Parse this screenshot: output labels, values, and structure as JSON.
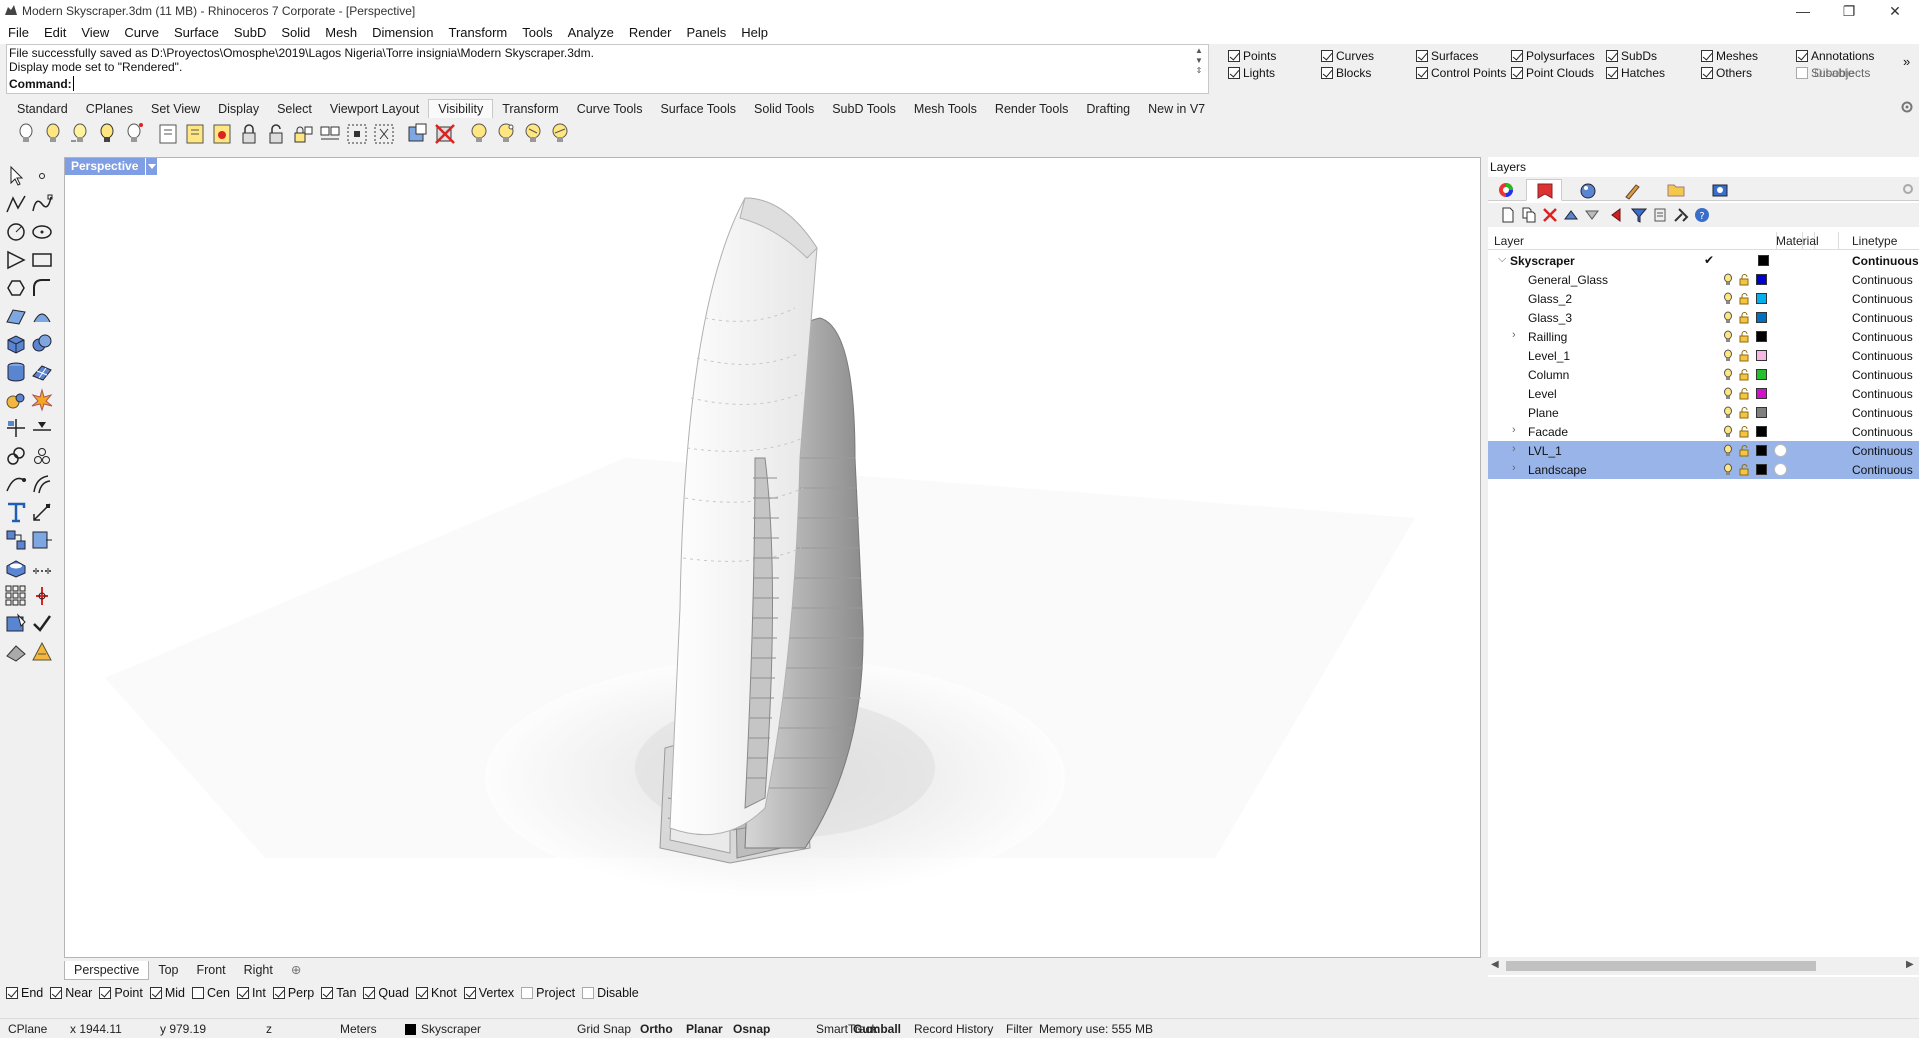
{
  "window": {
    "title": "Modern Skyscraper.3dm (11 MB) - Rhinoceros 7 Corporate - [Perspective]",
    "minimize": "—",
    "maximize": "❐",
    "close": "✕"
  },
  "menu": [
    "File",
    "Edit",
    "View",
    "Curve",
    "Surface",
    "SubD",
    "Solid",
    "Mesh",
    "Dimension",
    "Transform",
    "Tools",
    "Analyze",
    "Render",
    "Panels",
    "Help"
  ],
  "command": {
    "history": [
      "File successfully saved as D:\\Proyectos\\Omosphe\\2019\\Lagos Nigeria\\Torre insignia\\Modern Skyscraper.3dm.",
      "Display mode set to \"Rendered\"."
    ],
    "prompt": "Command:"
  },
  "select_filters": [
    {
      "label": "Points",
      "checked": true
    },
    {
      "label": "Curves",
      "checked": true
    },
    {
      "label": "Surfaces",
      "checked": true
    },
    {
      "label": "Polysurfaces",
      "checked": true
    },
    {
      "label": "SubDs",
      "checked": true
    },
    {
      "label": "Meshes",
      "checked": true
    },
    {
      "label": "Annotations",
      "checked": true
    },
    {
      "label": "Lights",
      "checked": true
    },
    {
      "label": "Blocks",
      "checked": true
    },
    {
      "label": "Control Points",
      "checked": true
    },
    {
      "label": "Point Clouds",
      "checked": true
    },
    {
      "label": "Hatches",
      "checked": true
    },
    {
      "label": "Others",
      "checked": true
    },
    {
      "label": "Subobjects",
      "checked": false,
      "overlay": "Disable"
    }
  ],
  "filters_more": "»",
  "toolbar_tabs": [
    "Standard",
    "CPlanes",
    "Set View",
    "Display",
    "Select",
    "Viewport Layout",
    "Visibility",
    "Transform",
    "Curve Tools",
    "Surface Tools",
    "Solid Tools",
    "SubD Tools",
    "Mesh Tools",
    "Render Tools",
    "Drafting",
    "New in V7"
  ],
  "active_toolbar_tab": "Visibility",
  "visibility_icons": [
    "show-icon",
    "show-selected-icon",
    "hide-icon",
    "hide-swap-icon",
    "lock-icon",
    "unlock-icon",
    "lock-swap-icon",
    "unlock-selected-icon",
    "hide-points-icon",
    "show-points-icon",
    "show-edit-points-icon",
    "hide-all-points-icon",
    "isolate-icon",
    "unisolate-icon",
    "layer-off-icon",
    "layer-on-icon",
    "layer-isolate-icon",
    "layer-swap-icon"
  ],
  "viewport": {
    "name": "Perspective",
    "tabs": [
      "Perspective",
      "Top",
      "Front",
      "Right"
    ],
    "add_tab": "⊕"
  },
  "osnaps": [
    {
      "label": "End",
      "checked": true
    },
    {
      "label": "Near",
      "checked": true
    },
    {
      "label": "Point",
      "checked": true
    },
    {
      "label": "Mid",
      "checked": true
    },
    {
      "label": "Cen",
      "checked": false
    },
    {
      "label": "Int",
      "checked": true
    },
    {
      "label": "Perp",
      "checked": true
    },
    {
      "label": "Tan",
      "checked": true
    },
    {
      "label": "Quad",
      "checked": true
    },
    {
      "label": "Knot",
      "checked": true
    },
    {
      "label": "Vertex",
      "checked": true
    },
    {
      "label": "Project",
      "checked": false
    },
    {
      "label": "Disable",
      "checked": false
    }
  ],
  "status": {
    "cplane": "CPlane",
    "x": "x 1944.11",
    "y": "y 979.19",
    "z": "z",
    "units": "Meters",
    "layer": "Skyscraper",
    "grid_snap": "Grid Snap",
    "ortho": "Ortho",
    "planar": "Planar",
    "osnap": "Osnap",
    "smarttrack": "SmartTrack",
    "gumball": "Gumball",
    "record_history": "Record History",
    "filter": "Filter",
    "memory": "Memory use: 555 MB"
  },
  "layers_panel": {
    "title": "Layers",
    "col_layer": "Layer",
    "col_material": "Material",
    "col_linetype": "Linetype",
    "rows": [
      {
        "name": "Skyscraper",
        "color": "#000000",
        "linetype": "Continuous",
        "current": true,
        "parent": true,
        "expanded": true
      },
      {
        "name": "General_Glass",
        "color": "#0000cc",
        "linetype": "Continuous"
      },
      {
        "name": "Glass_2",
        "color": "#00b0ef",
        "linetype": "Continuous"
      },
      {
        "name": "Glass_3",
        "color": "#0070c0",
        "linetype": "Continuous"
      },
      {
        "name": "Railling",
        "color": "#000000",
        "linetype": "Continuous",
        "collapsible": true
      },
      {
        "name": "Level_1",
        "color": "#f6b9e6",
        "linetype": "Continuous"
      },
      {
        "name": "Column",
        "color": "#22c02a",
        "linetype": "Continuous"
      },
      {
        "name": "Level",
        "color": "#d012c8",
        "linetype": "Continuous"
      },
      {
        "name": "Plane",
        "color": "#7f7f7f",
        "linetype": "Continuous"
      },
      {
        "name": "Facade",
        "color": "#000000",
        "linetype": "Continuous",
        "collapsible": true
      },
      {
        "name": "LVL_1",
        "color": "#000000",
        "linetype": "Continuous",
        "collapsible": true,
        "selected": true,
        "material": true
      },
      {
        "name": "Landscape",
        "color": "#000000",
        "linetype": "Continuous",
        "collapsible": true,
        "selected": true,
        "material": true
      }
    ]
  }
}
